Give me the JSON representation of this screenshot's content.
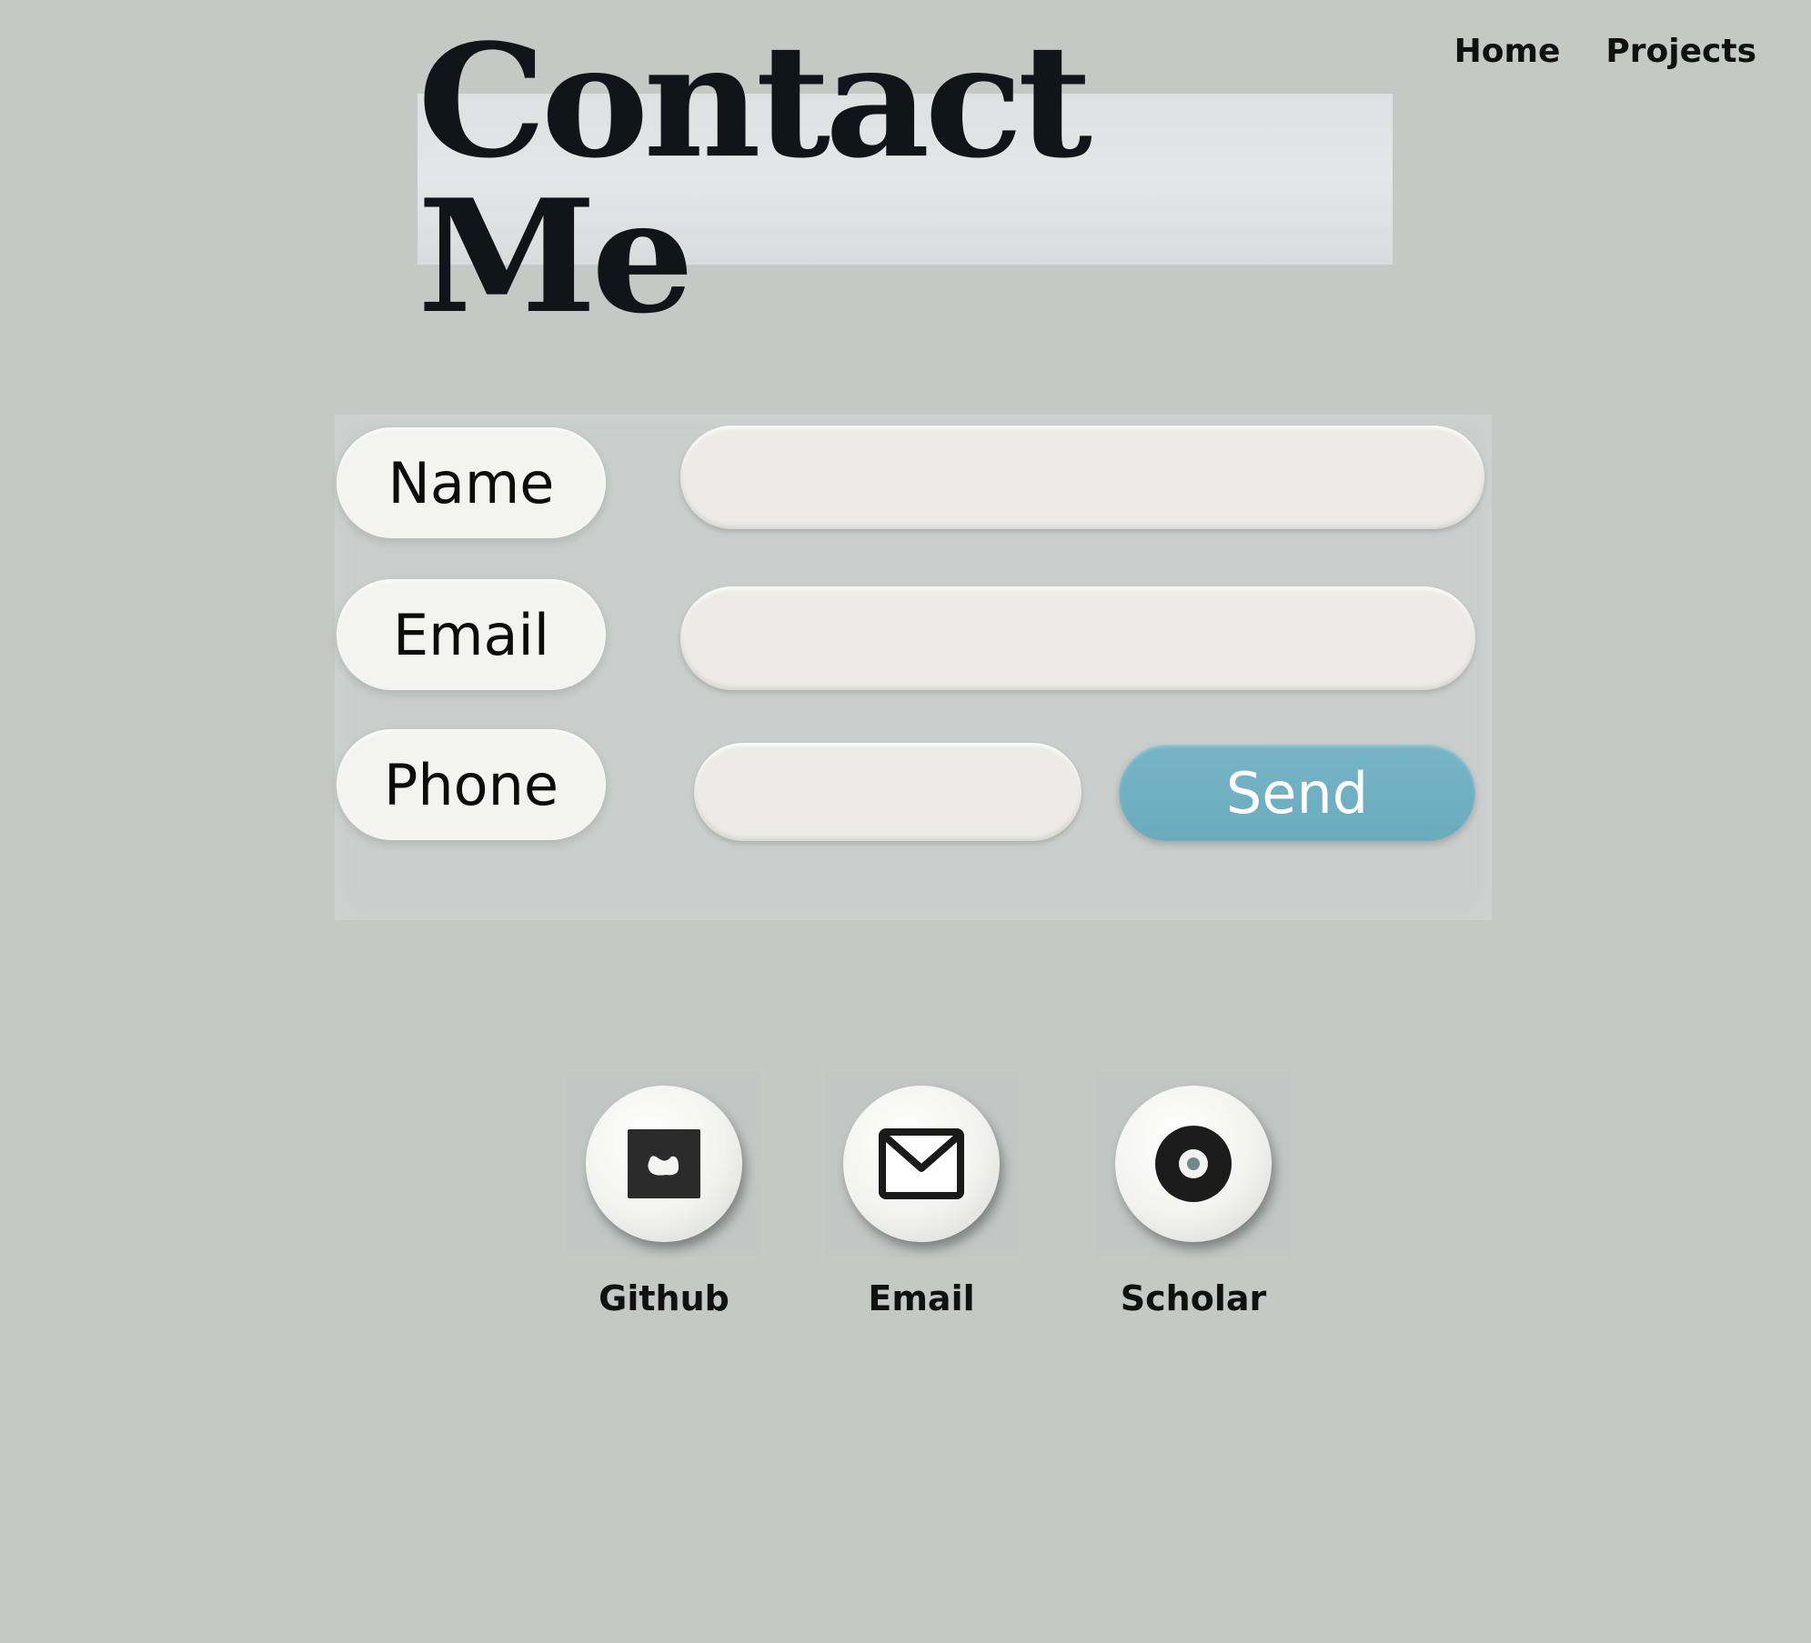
{
  "nav": {
    "items": [
      {
        "label": "Home"
      },
      {
        "label": "Projects"
      }
    ]
  },
  "title": "Contact Me",
  "form": {
    "name_label": "Name",
    "email_label": "Email",
    "phone_label": "Phone",
    "name_placeholder": "",
    "email_placeholder": "",
    "phone_placeholder": "",
    "send_label": "Send"
  },
  "social": [
    {
      "label": "Github",
      "icon": "github-icon"
    },
    {
      "label": "Email",
      "icon": "mail-icon"
    },
    {
      "label": "Scholar",
      "icon": "scholar-icon"
    }
  ],
  "colors": {
    "background": "#c4c9c5",
    "send_button": "#6fafc2",
    "pill": "#f3f3f1"
  }
}
